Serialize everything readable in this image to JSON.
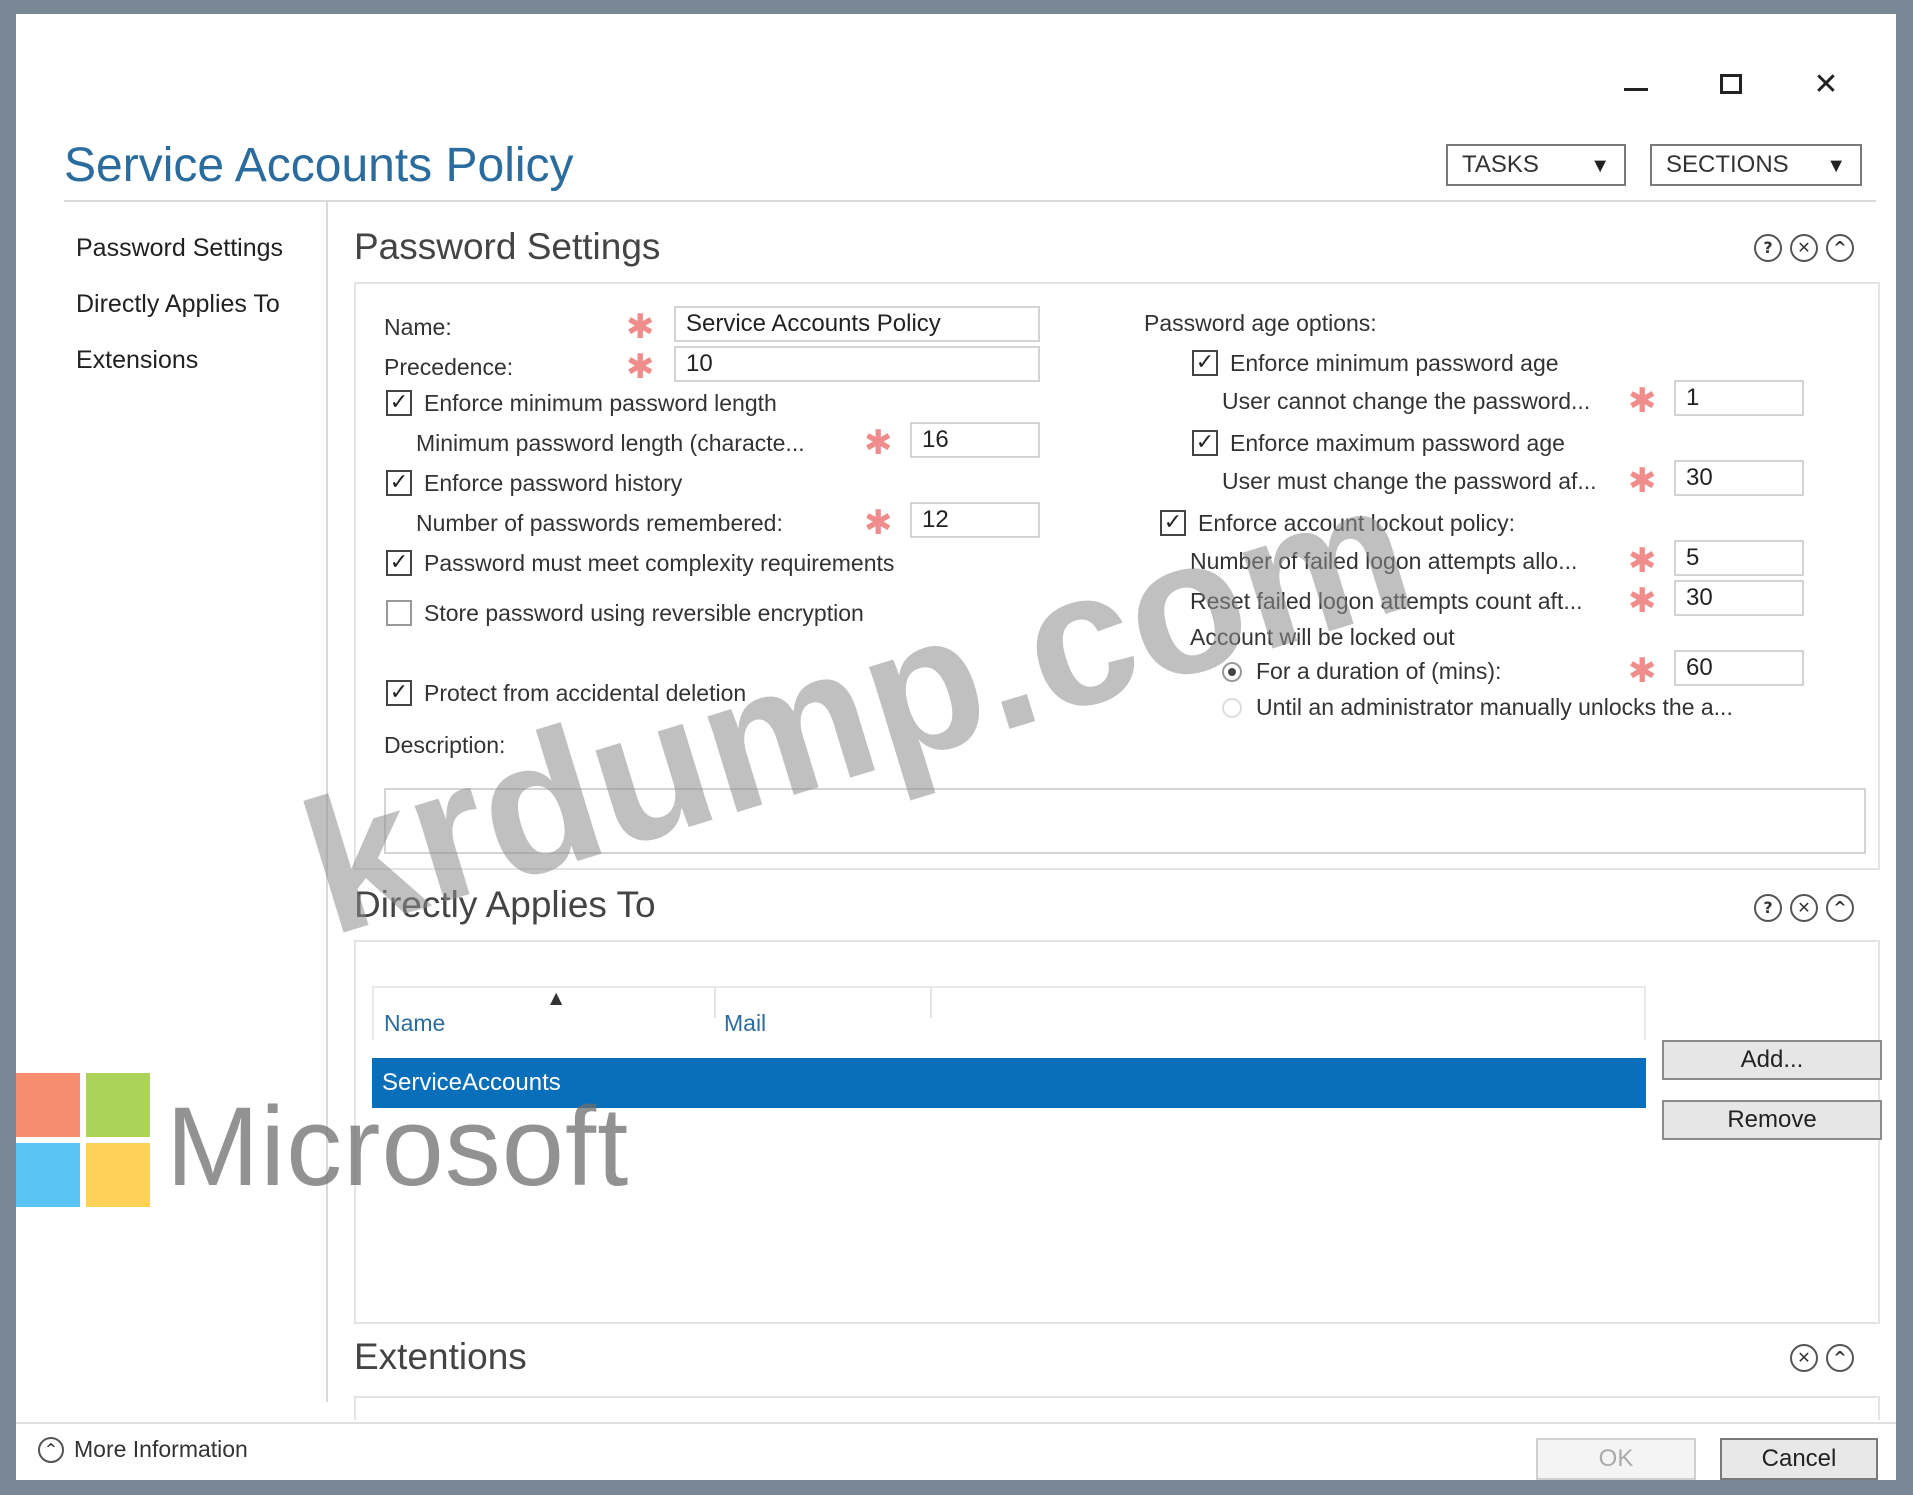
{
  "window": {
    "title": "Service Accounts Policy",
    "controls": {
      "minimize": "—",
      "maximize": "☐",
      "close": "✕"
    }
  },
  "header": {
    "tasks_label": "TASKS",
    "sections_label": "SECTIONS",
    "dropdown_arrow": "▼"
  },
  "nav": {
    "items": [
      {
        "label": "Password Settings"
      },
      {
        "label": "Directly Applies To"
      },
      {
        "label": "Extensions"
      }
    ]
  },
  "password_settings": {
    "title": "Password Settings",
    "name_label": "Name:",
    "name_value": "Service Accounts Policy",
    "precedence_label": "Precedence:",
    "precedence_value": "10",
    "enforce_min_length_label": "Enforce minimum password length",
    "enforce_min_length_checked": true,
    "min_length_label": "Minimum password length (characte...",
    "min_length_value": "16",
    "enforce_history_label": "Enforce password history",
    "enforce_history_checked": true,
    "history_count_label": "Number of passwords remembered:",
    "history_count_value": "12",
    "complexity_label": "Password must meet complexity requirements",
    "complexity_checked": true,
    "reversible_label": "Store password using reversible encryption",
    "reversible_checked": false,
    "protect_label": "Protect from accidental deletion",
    "protect_checked": true,
    "description_label": "Description:",
    "description_value": "",
    "age_options_label": "Password age options:",
    "enforce_min_age_label": "Enforce minimum password age",
    "enforce_min_age_checked": true,
    "min_age_label": "User cannot change the password...",
    "min_age_value": "1",
    "enforce_max_age_label": "Enforce maximum password age",
    "enforce_max_age_checked": true,
    "max_age_label": "User must change the password af...",
    "max_age_value": "30",
    "lockout_label": "Enforce account lockout policy:",
    "lockout_checked": true,
    "failed_attempts_label": "Number of failed logon attempts allo...",
    "failed_attempts_value": "5",
    "reset_count_label": "Reset failed logon attempts count aft...",
    "reset_count_value": "30",
    "locked_out_label": "Account will be locked out",
    "duration_label": "For a duration of (mins):",
    "duration_value": "60",
    "duration_selected": true,
    "until_admin_label": "Until an administrator manually unlocks the a...",
    "until_admin_selected": false,
    "required_marker": "✱",
    "check_mark": "✓"
  },
  "directly_applies_to": {
    "title": "Directly Applies To",
    "columns": [
      "Name",
      "Mail"
    ],
    "sort_indicator": "▲",
    "rows": [
      {
        "name": "ServiceAccounts",
        "mail": "",
        "selected": true
      }
    ],
    "add_label": "Add...",
    "remove_label": "Remove"
  },
  "extensions": {
    "title": "Extentions"
  },
  "section_icons": {
    "help": "?",
    "close": "✕",
    "collapse": "^"
  },
  "footer": {
    "more_info_label": "More Information",
    "more_info_icon": "^",
    "ok_label": "OK",
    "cancel_label": "Cancel"
  },
  "overlay": {
    "watermark": "krdump.com",
    "logo_text": "Microsoft",
    "logo_colors": [
      "#f25022",
      "#7fba00",
      "#00a4ef",
      "#ffb900"
    ]
  }
}
